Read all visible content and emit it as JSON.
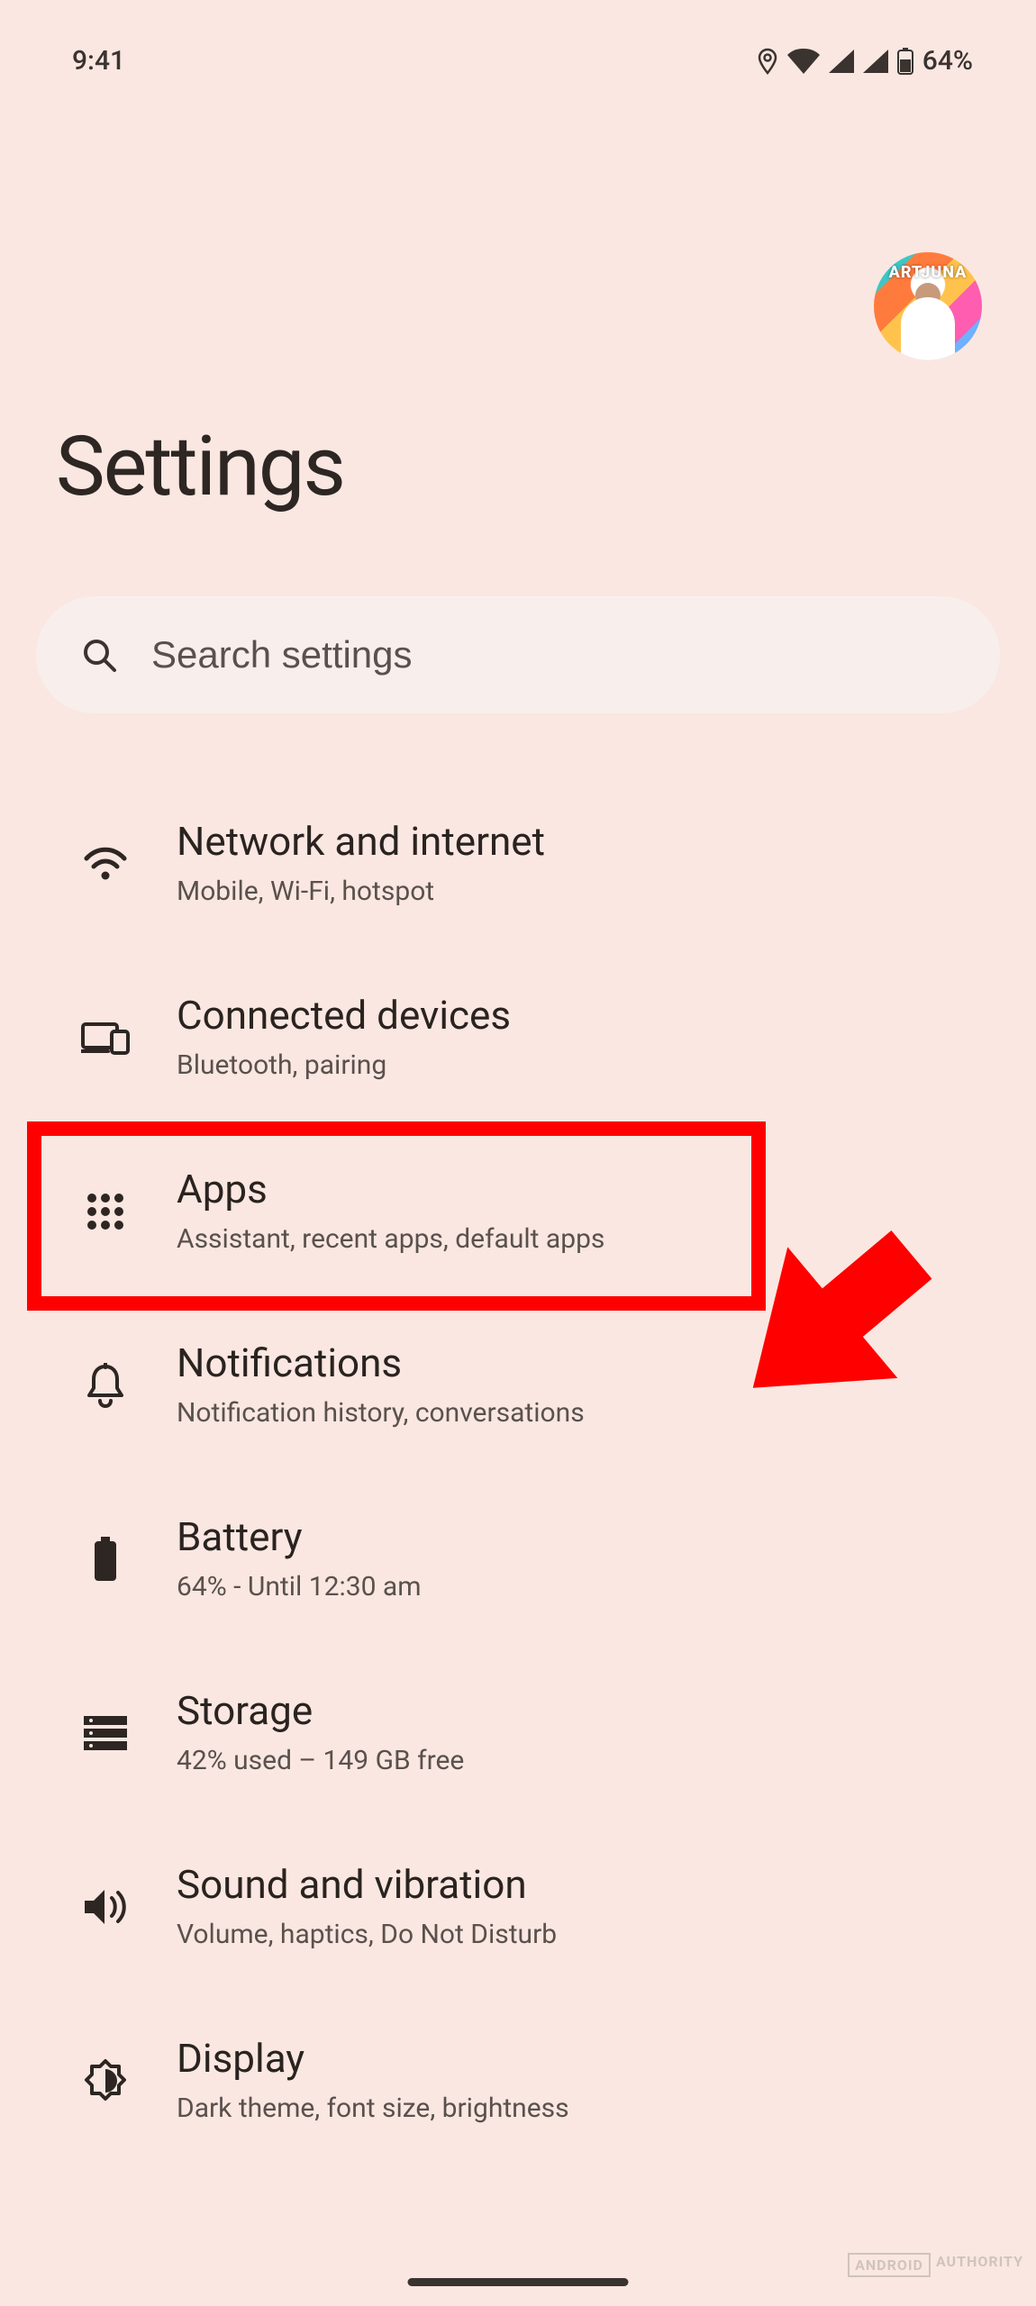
{
  "status": {
    "time": "9:41",
    "battery_text": "64%"
  },
  "avatar": {
    "label": "ARTJUNA"
  },
  "title": "Settings",
  "search": {
    "placeholder": "Search settings"
  },
  "items": [
    {
      "icon": "wifi-icon",
      "label": "Network and internet",
      "sub": "Mobile, Wi-Fi, hotspot"
    },
    {
      "icon": "devices-icon",
      "label": "Connected devices",
      "sub": "Bluetooth, pairing"
    },
    {
      "icon": "apps-icon",
      "label": "Apps",
      "sub": "Assistant, recent apps, default apps"
    },
    {
      "icon": "notifications-icon",
      "label": "Notifications",
      "sub": "Notification history, conversations"
    },
    {
      "icon": "battery-icon",
      "label": "Battery",
      "sub": "64% - Until 12:30 am"
    },
    {
      "icon": "storage-icon",
      "label": "Storage",
      "sub": "42% used – 149 GB free"
    },
    {
      "icon": "sound-icon",
      "label": "Sound and vibration",
      "sub": "Volume, haptics, Do Not Disturb"
    },
    {
      "icon": "display-icon",
      "label": "Display",
      "sub": "Dark theme, font size, brightness"
    }
  ],
  "watermark": {
    "a": "ANDROID",
    "b": "AUTHORITY"
  }
}
